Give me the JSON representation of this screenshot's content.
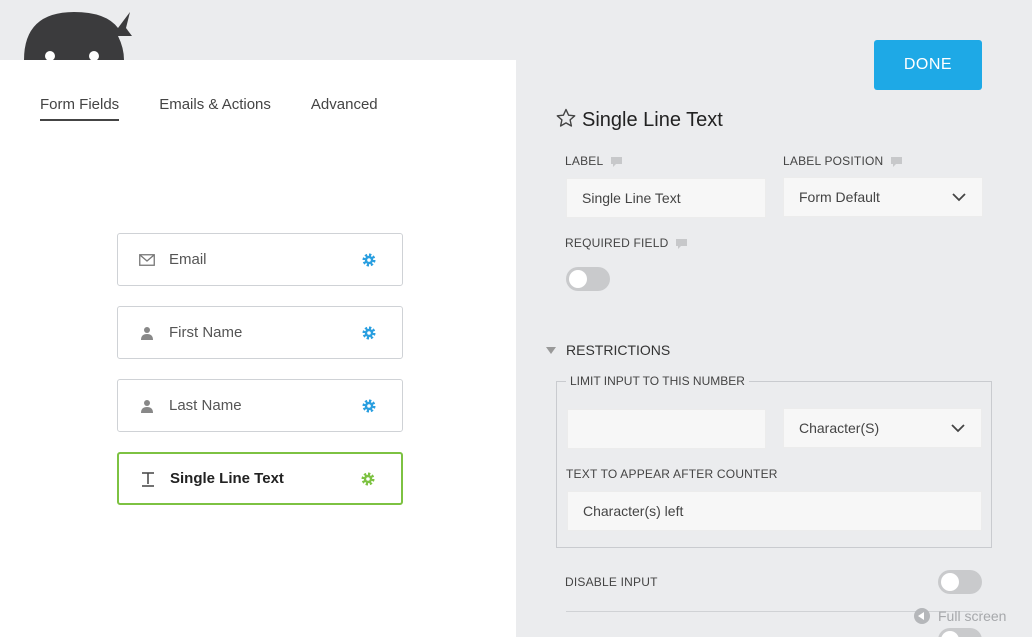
{
  "tabs": [
    {
      "label": "Form Fields",
      "active": true
    },
    {
      "label": "Emails & Actions",
      "active": false
    },
    {
      "label": "Advanced",
      "active": false
    }
  ],
  "fields": [
    {
      "label": "Email",
      "icon": "envelope-icon"
    },
    {
      "label": "First Name",
      "icon": "user-icon"
    },
    {
      "label": "Last Name",
      "icon": "user-icon"
    },
    {
      "label": "Single Line Text",
      "icon": "text-icon",
      "active": true
    }
  ],
  "toolbar": {
    "done_label": "DONE"
  },
  "settings": {
    "title": "Single Line Text",
    "label_label": "LABEL",
    "label_value": "Single Line Text",
    "label_position_label": "LABEL POSITION",
    "label_position_value": "Form Default",
    "required_label": "REQUIRED FIELD",
    "restrictions_label": "RESTRICTIONS",
    "limit_label": "LIMIT INPUT TO THIS NUMBER",
    "limit_value": "",
    "limit_unit": "Character(S)",
    "counter_label": "TEXT TO APPEAR AFTER COUNTER",
    "counter_value": "Character(s) left",
    "disable_label": "DISABLE INPUT"
  },
  "footer": {
    "fullscreen_label": "Full screen"
  },
  "colors": {
    "accent": "#1ea9e6",
    "active_border": "#7dc242",
    "gear_blue": "#2a9fe0",
    "gear_green": "#7dc242"
  }
}
